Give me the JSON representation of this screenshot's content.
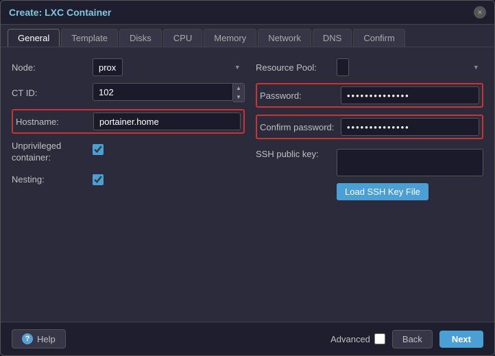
{
  "title": "Create: LXC Container",
  "close_icon": "×",
  "tabs": [
    {
      "id": "general",
      "label": "General",
      "active": true
    },
    {
      "id": "template",
      "label": "Template",
      "active": false
    },
    {
      "id": "disks",
      "label": "Disks",
      "active": false
    },
    {
      "id": "cpu",
      "label": "CPU",
      "active": false
    },
    {
      "id": "memory",
      "label": "Memory",
      "active": false
    },
    {
      "id": "network",
      "label": "Network",
      "active": false
    },
    {
      "id": "dns",
      "label": "DNS",
      "active": false
    },
    {
      "id": "confirm",
      "label": "Confirm",
      "active": false
    }
  ],
  "form": {
    "node_label": "Node:",
    "node_value": "prox",
    "ctid_label": "CT ID:",
    "ctid_value": "102",
    "hostname_label": "Hostname:",
    "hostname_value": "portainer.home",
    "unprivileged_label": "Unprivileged container:",
    "nesting_label": "Nesting:",
    "resource_pool_label": "Resource Pool:",
    "password_label": "Password:",
    "password_dots": "••••••••••••••••••••••••••••••••",
    "confirm_password_label": "Confirm password:",
    "confirm_password_dots": "••••••••••••••••••••••••••••••••",
    "ssh_public_key_label": "SSH public key:",
    "load_ssh_btn": "Load SSH Key File"
  },
  "footer": {
    "help_label": "Help",
    "advanced_label": "Advanced",
    "back_label": "Back",
    "next_label": "Next"
  }
}
